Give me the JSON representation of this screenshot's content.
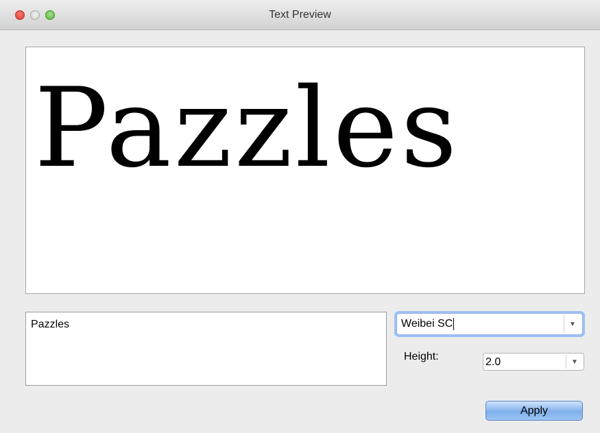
{
  "window": {
    "title": "Text Preview"
  },
  "preview": {
    "text": "Pazzles"
  },
  "text_input": {
    "value": "Pazzles"
  },
  "font_combo": {
    "value": "Weibei SC",
    "arrow": "▼"
  },
  "height": {
    "label": "Height:",
    "value": "2.0",
    "arrow": "▼"
  },
  "apply_label": "Apply",
  "colors": {
    "accent": "#9ec1f4",
    "button": "#7fb0ec",
    "window_bg": "#ececec"
  },
  "icons": [
    "close-icon",
    "minimize-icon",
    "zoom-icon",
    "chevron-down-icon"
  ]
}
